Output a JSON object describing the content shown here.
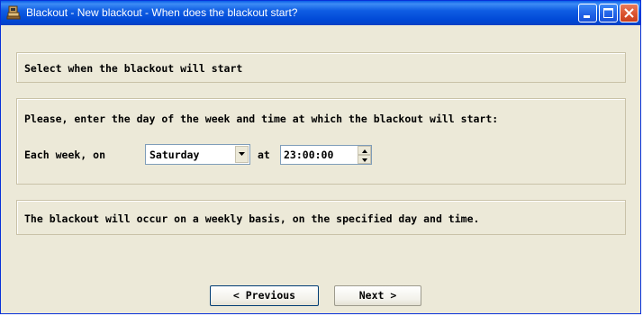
{
  "window": {
    "title": "Blackout - New blackout - When does the blackout start?",
    "accent": "#0054e3"
  },
  "header_panel": {
    "text": "Select when the blackout will start"
  },
  "input_panel": {
    "instruction": "Please, enter the day of the week and time at which the blackout will start:",
    "each_week_label": "Each week, on",
    "day_value": "Saturday",
    "at_label": "at",
    "time_value": "23:00:00"
  },
  "info_panel": {
    "text": "The blackout will occur on a weekly basis, on the specified day and time."
  },
  "buttons": {
    "previous": "< Previous",
    "next": "Next >"
  },
  "icons": {
    "app": "blackout-app-icon",
    "minimize": "minimize-icon",
    "maximize": "maximize-icon",
    "close": "close-icon"
  }
}
